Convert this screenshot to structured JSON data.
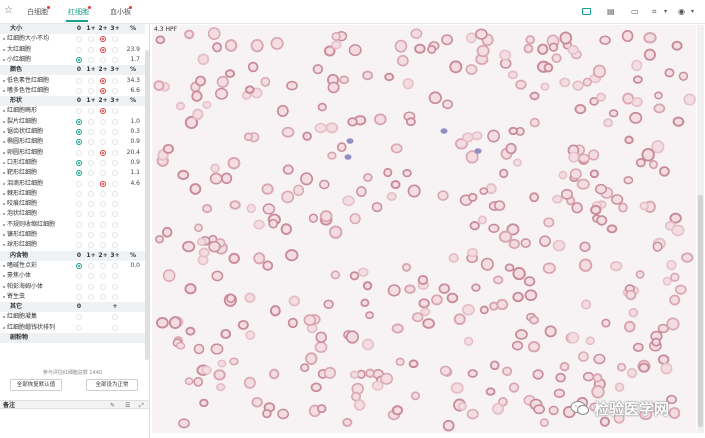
{
  "tabs": [
    {
      "label": "白细胞",
      "active": false
    },
    {
      "label": "红细胞",
      "active": true
    },
    {
      "label": "血小板",
      "active": false
    }
  ],
  "columns": [
    "0",
    "1+",
    "2+",
    "3+",
    "%"
  ],
  "rows": [
    {
      "type": "header",
      "label": "大小"
    },
    {
      "type": "item",
      "label": "红细胞大小不均",
      "sel": 2,
      "color": "red",
      "value": ""
    },
    {
      "type": "item",
      "label": "大红细胞",
      "sel": 2,
      "color": "red",
      "value": "23.9"
    },
    {
      "type": "item",
      "label": "小红细胞",
      "sel": 0,
      "color": "green",
      "value": "1.7"
    },
    {
      "type": "header",
      "label": "颜色"
    },
    {
      "type": "item",
      "label": "低色素性红细胞",
      "sel": 2,
      "color": "red",
      "value": "34.3"
    },
    {
      "type": "item",
      "label": "嗜多色性红细胞",
      "sel": 2,
      "color": "red",
      "value": "6.6"
    },
    {
      "type": "header",
      "label": "形状"
    },
    {
      "type": "item",
      "label": "红细胞畸形",
      "sel": 2,
      "color": "red",
      "value": ""
    },
    {
      "type": "item",
      "label": "裂片红细胞",
      "sel": 0,
      "color": "green",
      "value": "1.0"
    },
    {
      "type": "item",
      "label": "锯齿状红细胞",
      "sel": 0,
      "color": "green",
      "value": "0.3"
    },
    {
      "type": "item",
      "label": "椭圆形红细胞",
      "sel": 0,
      "color": "green",
      "value": "0.9"
    },
    {
      "type": "item",
      "label": "卵圆形红细胞",
      "sel": 2,
      "color": "red",
      "value": "20.4"
    },
    {
      "type": "item",
      "label": "口形红细胞",
      "sel": 0,
      "color": "green",
      "value": "0.9"
    },
    {
      "type": "item",
      "label": "靶形红细胞",
      "sel": 0,
      "color": "green",
      "value": "1.1"
    },
    {
      "type": "item",
      "label": "泪滴形红细胞",
      "sel": 2,
      "color": "red",
      "value": "4.6"
    },
    {
      "type": "item",
      "label": "棘形红细胞",
      "sel": -1,
      "color": "",
      "value": ""
    },
    {
      "type": "item",
      "label": "咬痕红细胞",
      "sel": -1,
      "color": "",
      "value": ""
    },
    {
      "type": "item",
      "label": "泡状红细胞",
      "sel": -1,
      "color": "",
      "value": ""
    },
    {
      "type": "item",
      "label": "不规则收缩红细胞",
      "sel": -1,
      "color": "",
      "value": ""
    },
    {
      "type": "item",
      "label": "镰形红细胞",
      "sel": -1,
      "color": "",
      "value": ""
    },
    {
      "type": "item",
      "label": "球形红细胞",
      "sel": -1,
      "color": "",
      "value": ""
    },
    {
      "type": "header",
      "label": "内含物"
    },
    {
      "type": "item",
      "label": "嗜碱性点彩",
      "sel": 0,
      "color": "green",
      "value": "0.0"
    },
    {
      "type": "item",
      "label": "豪焦小体",
      "sel": -1,
      "color": "",
      "value": ""
    },
    {
      "type": "item",
      "label": "帕彭海姆小体",
      "sel": -1,
      "color": "",
      "value": ""
    },
    {
      "type": "item",
      "label": "寄生虫",
      "sel": -1,
      "color": "",
      "value": ""
    },
    {
      "type": "header2",
      "label": "其它",
      "c0": "0",
      "c3": "+"
    },
    {
      "type": "item2",
      "label": "红细胞凝集"
    },
    {
      "type": "item2",
      "label": "红细胞缗钱状排列"
    },
    {
      "type": "header3",
      "label": "剧粉物"
    }
  ],
  "total_text": "参与评估红细胞总数 1440",
  "btn_default": "全部恢复默认值",
  "btn_normal": "全部设为正常",
  "notes_title": "备注",
  "hpf_label": "4.3 HPF",
  "watermark": "检验医学网",
  "icons": {
    "star": "star-icon",
    "toolbar": [
      "image-icon",
      "folder-icon",
      "screen-icon",
      "crop-icon",
      "eye-icon"
    ]
  },
  "accent": "#1a9e8f",
  "alert": "#e23b3b"
}
